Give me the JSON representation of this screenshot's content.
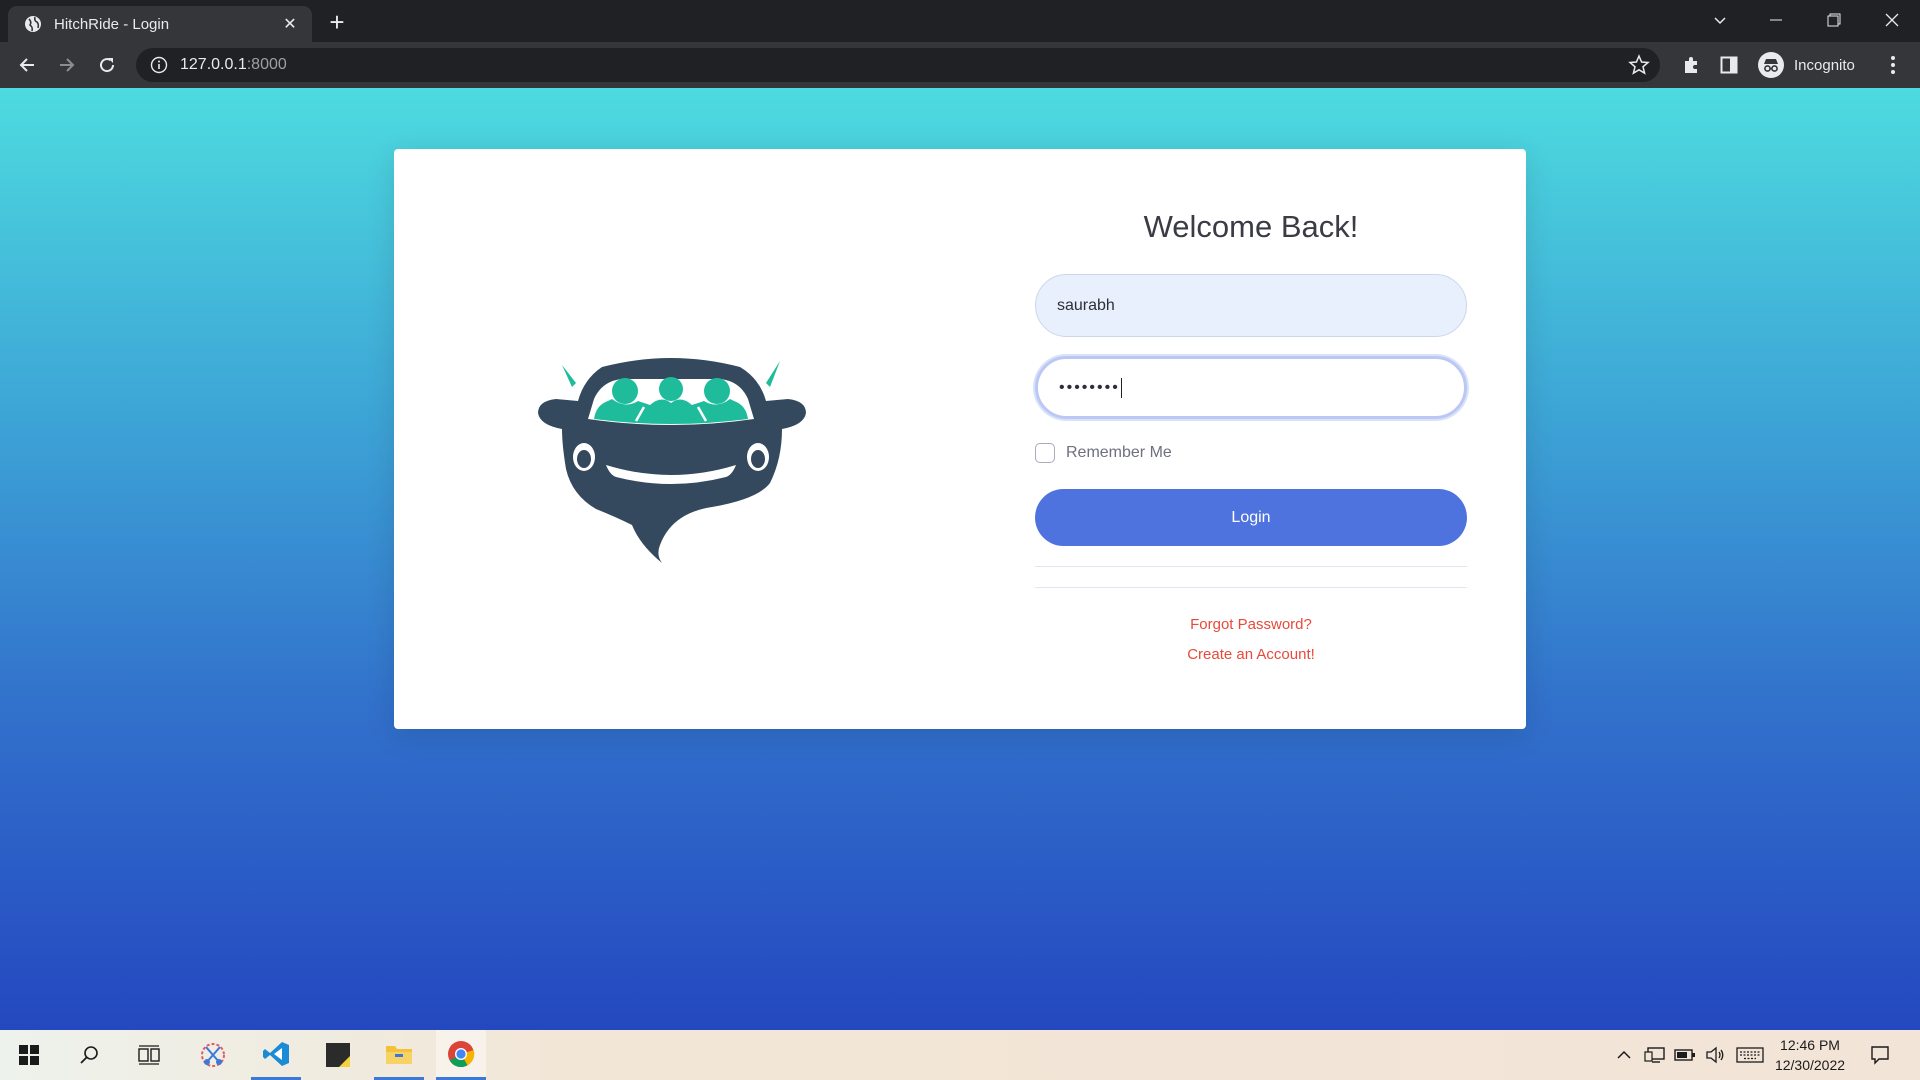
{
  "browser": {
    "tab_title": "HitchRide - Login",
    "url_host": "127.0.0.1",
    "url_port": ":8000",
    "profile_label": "Incognito"
  },
  "login": {
    "heading": "Welcome Back!",
    "username_value": "saurabh",
    "password_mask": "••••••••",
    "remember_label": "Remember Me",
    "login_button": "Login",
    "forgot_link": "Forgot Password?",
    "create_link": "Create an Account!"
  },
  "taskbar": {
    "time": "12:46 PM",
    "date": "12/30/2022"
  },
  "colors": {
    "primary": "#4e73df",
    "link": "#e74a3b",
    "logo_dark": "#34495e",
    "logo_accent": "#1fbc9c"
  }
}
